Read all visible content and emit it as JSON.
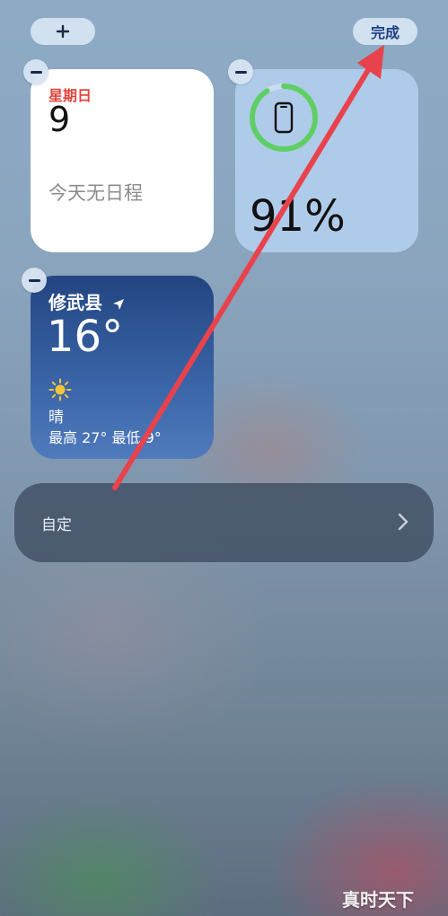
{
  "top_bar": {
    "add_label": "+",
    "done_label": "完成"
  },
  "calendar_widget": {
    "weekday": "星期日",
    "day": "9",
    "empty_text": "今天无日程"
  },
  "battery_widget": {
    "percent": "91%",
    "level": 0.91,
    "ring_color": "#5fcf65"
  },
  "weather_widget": {
    "city": "修武县",
    "temperature": "16°",
    "condition": "晴",
    "high_low": "最高 27° 最低 9°"
  },
  "customize_bar": {
    "label": "自定"
  },
  "watermark": {
    "text": "真时天下"
  },
  "colors": {
    "annotation_arrow": "#e8424c",
    "accent_red": "#e5433b"
  }
}
